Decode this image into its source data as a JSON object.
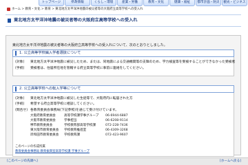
{
  "nav": {
    "tabs": [
      "トップページ",
      "県政情報",
      "くらし・環境",
      "産業・労働",
      "教育・文化",
      "健康・福祉",
      "都市計画・防災",
      "観光・ビジネス"
    ]
  },
  "breadcrumb": "ホーム > 教育・文化 > 教育 > 東北地方太平洋沖地震の被災者等の大阪府立高等学校への受入れ",
  "title": "東北地方太平洋沖地震の被災者等の大阪府立高等学校への受入れ",
  "intro": "東北地方太平洋沖地震の被災者等の大阪府立高等学校への受入れについて、次のとおりとしました。",
  "section1": {
    "heading": "1. 公立高等学校編入学者選抜について",
    "rows": [
      {
        "key": "(対象)",
        "text": "東北地方太平洋沖地震に被災したため、または、同地震による交通機関等の支障のため、学力検査等を受検することができなかった受検者"
      },
      {
        "key": "(手続)",
        "text": "受検者は、住居所在地を管轄する府立高等学校に事前に連絡をしてください。"
      }
    ]
  },
  "section2": {
    "heading": "2. 公立高等学校への転入学等について",
    "rows": [
      {
        "key": "(対象)",
        "text": "東北地方太平洋沖地震に被災した生徒等で、大阪府内に転居された方"
      },
      {
        "key": "(手続)",
        "text": "希望する府立高等学校に相談してください。"
      },
      {
        "key": "(問合せ)",
        "text": "各教育委員会事務局(下記参照)を通じて受け付けています。"
      }
    ],
    "contacts": [
      {
        "org": "大阪府教育委員会",
        "dept": "高等学校課学事グループ",
        "tel": "06-6944-6887"
      },
      {
        "org": "大阪市教育委員会",
        "dept": "学事担当",
        "tel": "06-6208-9114"
      },
      {
        "org": "堺市教育委員会",
        "dept": "学校教育部高等学校課",
        "tel": "072-228-7436"
      },
      {
        "org": "東大阪市教育委員会",
        "dept": "学校教育推進室",
        "tel": "06-4309-3268"
      },
      {
        "org": "岸和田市教育委員会",
        "dept": "学校教育課",
        "tel": "072-423-9607"
      }
    ]
  },
  "note": "このページの作成所属",
  "link": "教育委員会事務局 教育振興室高等学校課 学事グループ",
  "footer": {
    "left": "[このページの先頭へ]",
    "right": "[ホームへ戻る]"
  }
}
